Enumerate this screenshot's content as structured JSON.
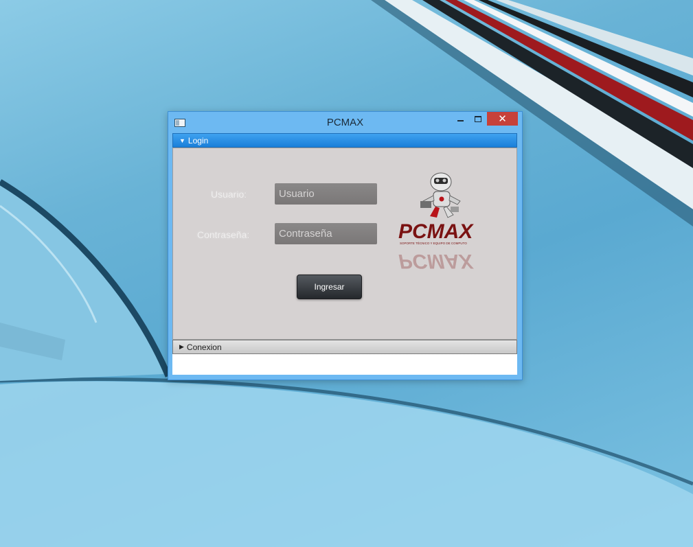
{
  "window": {
    "title": "PCMAX",
    "close_symbol": "✕"
  },
  "panes": {
    "login": {
      "arrow": "▼",
      "label": "Login",
      "user_label": "Usuario:",
      "user_placeholder": "Usuario",
      "user_value": "",
      "password_label": "Contraseña:",
      "password_placeholder": "Contraseña",
      "password_value": "",
      "submit_label": "Ingresar"
    },
    "conexion": {
      "arrow": "▶",
      "label": "Conexion"
    }
  },
  "logo": {
    "brand": "PCMAX",
    "tagline": "SOPORTE TÉCNICO Y EQUIPO DE COMPUTO",
    "icon": "robot-icon"
  },
  "colors": {
    "titlebar": "#6db9f2",
    "close_button": "#c7413a",
    "login_header": "#1a7fd9",
    "login_panel": "#d6d2d2",
    "logo_red": "#7a1212"
  }
}
